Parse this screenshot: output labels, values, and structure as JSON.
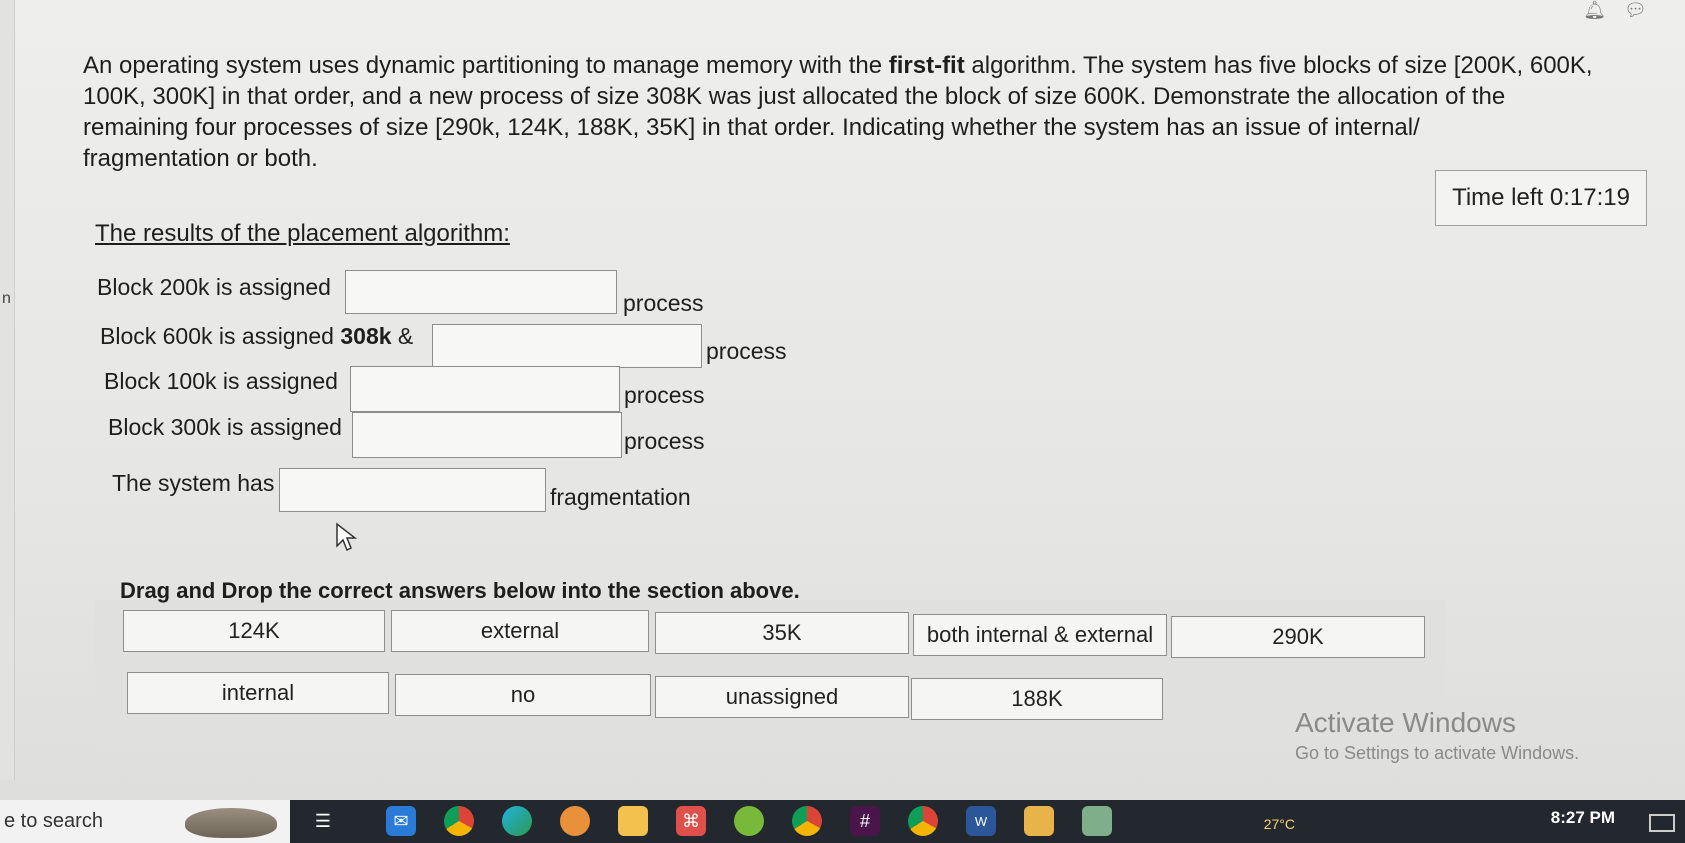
{
  "question": {
    "line1_pre": "An operating system uses dynamic partitioning to manage memory with the ",
    "line1_bold": "first-fit",
    "line1_post": " algorithm. The system has five blocks of size [200K, 600K,",
    "line2": "100K, 300K] in that order, and a new process of size 308K was just allocated the block of size 600K. Demonstrate the allocation of the",
    "line3": "remaining four processes of size [290k, 124K, 188K, 35K] in that order. Indicating whether the system has an issue of internal/",
    "line4": "fragmentation or both."
  },
  "timer": {
    "text": "Time left 0:17:19"
  },
  "results": {
    "title": "The results of the placement algorithm:",
    "rows": [
      {
        "label": "Block 200k is assigned",
        "prefix_bold": "",
        "prefix_tail": "",
        "suffix": "process"
      },
      {
        "label": "Block 600k is assigned ",
        "prefix_bold": "308k",
        "prefix_tail": " &",
        "suffix": "process"
      },
      {
        "label": "Block 100k is assigned",
        "prefix_bold": "",
        "prefix_tail": "",
        "suffix": "process"
      },
      {
        "label": "Block 300k is assigned",
        "prefix_bold": "",
        "prefix_tail": "",
        "suffix": "process"
      },
      {
        "label": "The system has",
        "prefix_bold": "",
        "prefix_tail": "",
        "suffix": "fragmentation"
      }
    ]
  },
  "dnd": {
    "title": "Drag and Drop the correct answers below into the section above.",
    "tiles": [
      "124K",
      "external",
      "35K",
      "both internal & external",
      "290K",
      "internal",
      "no",
      "unassigned",
      "188K"
    ]
  },
  "watermark": {
    "title": "Activate Windows",
    "subtitle": "Go to Settings to activate Windows."
  },
  "taskbar": {
    "search_text": "e to search",
    "temperature": "27°C",
    "clock": "8:27 PM",
    "icons": [
      "task-view-icon",
      "mail-icon",
      "chrome-icon",
      "edge-icon",
      "vpn-icon",
      "file-explorer-icon",
      "app-icon",
      "torrent-icon",
      "chrome-profile-icon",
      "slack-icon",
      "chrome-alt-icon",
      "word-icon",
      "files-icon",
      "app-alt-icon"
    ]
  },
  "left_edge_char": "n"
}
